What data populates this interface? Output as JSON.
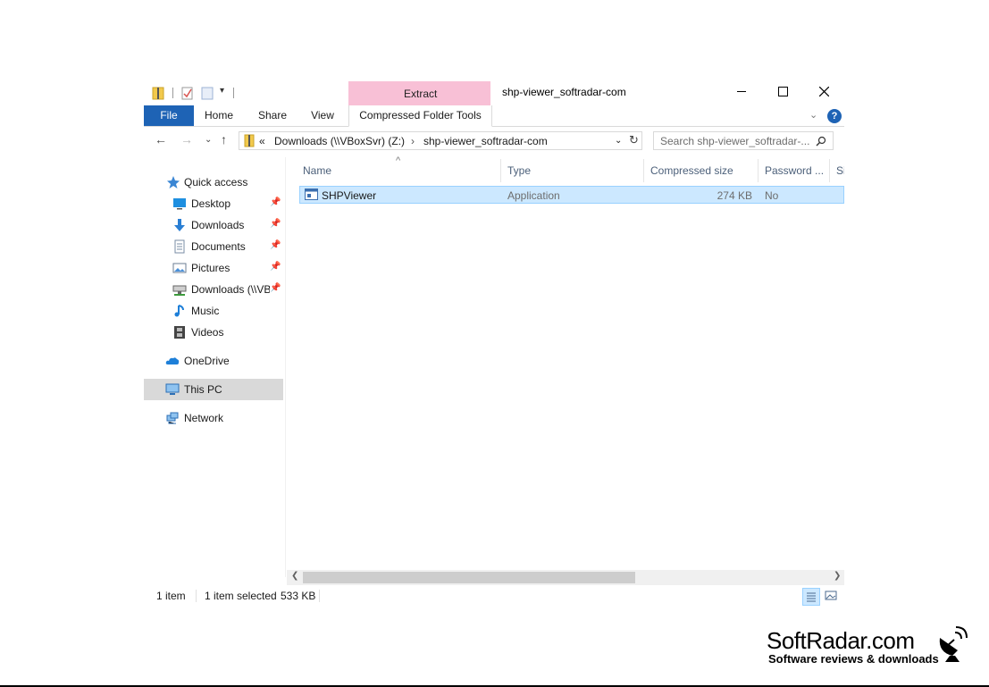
{
  "window": {
    "title": "shp-viewer_softradar-com",
    "minimize": "minimize",
    "maximize": "maximize",
    "close": "close"
  },
  "ribbon": {
    "context_header": "Extract",
    "tabs": [
      "File",
      "Home",
      "Share",
      "View",
      "Compressed Folder Tools"
    ],
    "help": "?"
  },
  "address_bar": {
    "overflow": "«",
    "crumbs": [
      "Downloads (\\\\VBoxSvr) (Z:)",
      "shp-viewer_softradar-com"
    ],
    "search_placeholder": "Search shp-viewer_softradar-..."
  },
  "nav_pane": {
    "quick_access": "Quick access",
    "items": [
      {
        "label": "Desktop",
        "icon": "desktop-icon",
        "pinned": true
      },
      {
        "label": "Downloads",
        "icon": "downloads-icon",
        "pinned": true
      },
      {
        "label": "Documents",
        "icon": "documents-icon",
        "pinned": true
      },
      {
        "label": "Pictures",
        "icon": "pictures-icon",
        "pinned": true
      },
      {
        "label": "Downloads (\\\\VBoxSvr) (Z:)",
        "icon": "network-drive-icon",
        "pinned": true
      },
      {
        "label": "Music",
        "icon": "music-icon",
        "pinned": false
      },
      {
        "label": "Videos",
        "icon": "videos-icon",
        "pinned": false
      }
    ],
    "onedrive": "OneDrive",
    "this_pc": "This PC",
    "network": "Network"
  },
  "file_list": {
    "columns": [
      "Name",
      "Type",
      "Compressed size",
      "Password ...",
      "Si"
    ],
    "rows": [
      {
        "name": "SHPViewer",
        "type": "Application",
        "compressed_size": "274 KB",
        "password": "No"
      }
    ]
  },
  "status_bar": {
    "item_count": "1 item",
    "selection": "1 item selected",
    "size": "533 KB"
  },
  "watermark": {
    "title": "SoftRadar.com",
    "subtitle": "Software reviews & downloads"
  },
  "colors": {
    "accent": "#1e63b5",
    "context_tab": "#f8c0d6",
    "selection": "#cce8ff",
    "selection_border": "#99d1ff"
  }
}
